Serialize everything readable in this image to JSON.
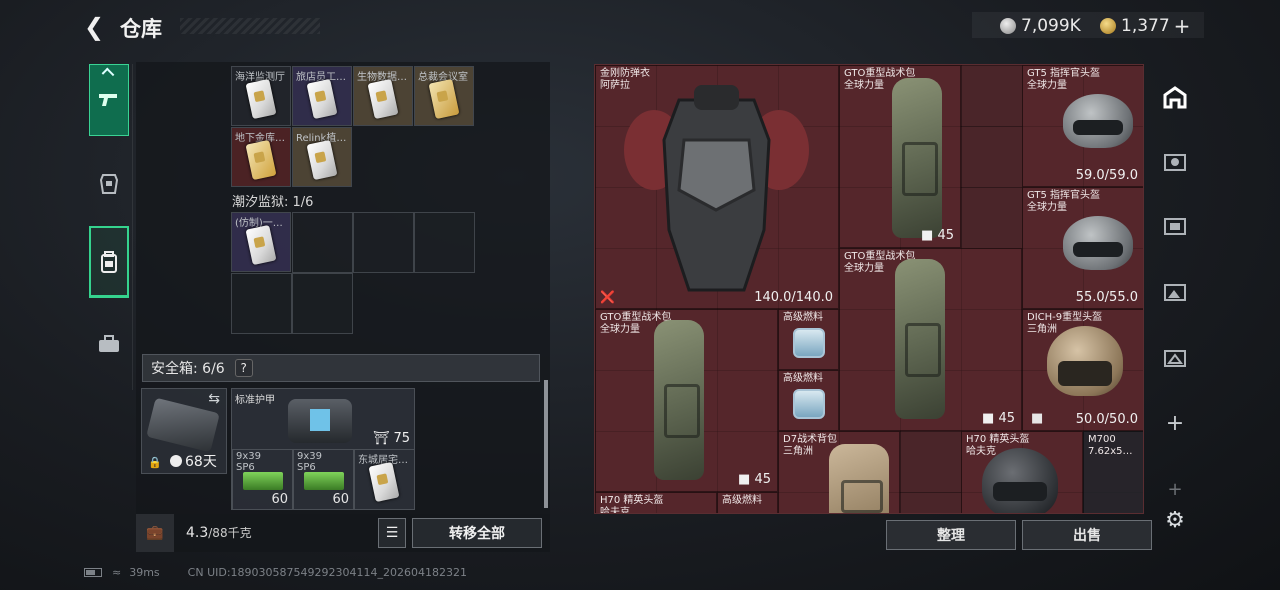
{
  "header": {
    "title": "仓库",
    "back_icon": "back-arrow-icon",
    "silver": "7,099K",
    "gold": "1,377",
    "plus": "+"
  },
  "nav": {
    "items": [
      "pistol-icon",
      "armor-icon",
      "backpack-icon",
      "briefcase-icon"
    ],
    "active": "backpack-icon"
  },
  "left": {
    "row1_labels": [
      "海洋监测厅",
      "旅店员工…",
      "生物数据…",
      "总裁会议室"
    ],
    "row2_labels": [
      "地下金库…",
      "Relink植…"
    ],
    "prison_label": "潮汐监狱: 1/6",
    "prison_slot": "(仿制)一…",
    "safebox_label": "安全箱: 6/6",
    "safebox_help": "?",
    "case_days": "68天",
    "armor_label": "标准护甲",
    "armor_value": "75",
    "ammo1_label": "9x39\nSP6",
    "ammo1_count": "60",
    "ammo2_label": "9x39\nSP6",
    "ammo2_count": "60",
    "key_label": "东城居宅…",
    "weight": "4.3",
    "weight_max": "/88千克",
    "transfer_all": "转移全部"
  },
  "right": {
    "items": [
      {
        "name": "金刚防弹衣\n阿萨拉",
        "value": "140.0/140.0"
      },
      {
        "name": "GTO重型战术包\n全球力量",
        "count": "45"
      },
      {
        "name": "GT5 指挥官头盔\n全球力量",
        "value": "59.0/59.0"
      },
      {
        "name": "GT5 指挥官头盔\n全球力量",
        "value": "55.0/55.0"
      },
      {
        "name": "GTO重型战术包\n全球力量",
        "count": "45"
      },
      {
        "name": "GTO重型战术包\n全球力量",
        "count": "45"
      },
      {
        "name": "高级燃料"
      },
      {
        "name": "高级燃料"
      },
      {
        "name": "DICH-9重型头盔\n三角洲",
        "value": "50.0/50.0"
      },
      {
        "name": "D7战术背包\n三角洲"
      },
      {
        "name": "H70 精英头盔\n哈夫克"
      },
      {
        "name": "M700\n7.62x5…"
      },
      {
        "name": "H70 精英头盔\n哈夫克"
      },
      {
        "name": "高级燃料"
      }
    ],
    "sort": "整理",
    "sell": "出售"
  },
  "status": {
    "ping": "39ms",
    "uid": "CN UID:1890305875492923041​14_202604182321"
  },
  "colors": {
    "accent": "#35d38e",
    "item_bg": "#4a2529"
  }
}
